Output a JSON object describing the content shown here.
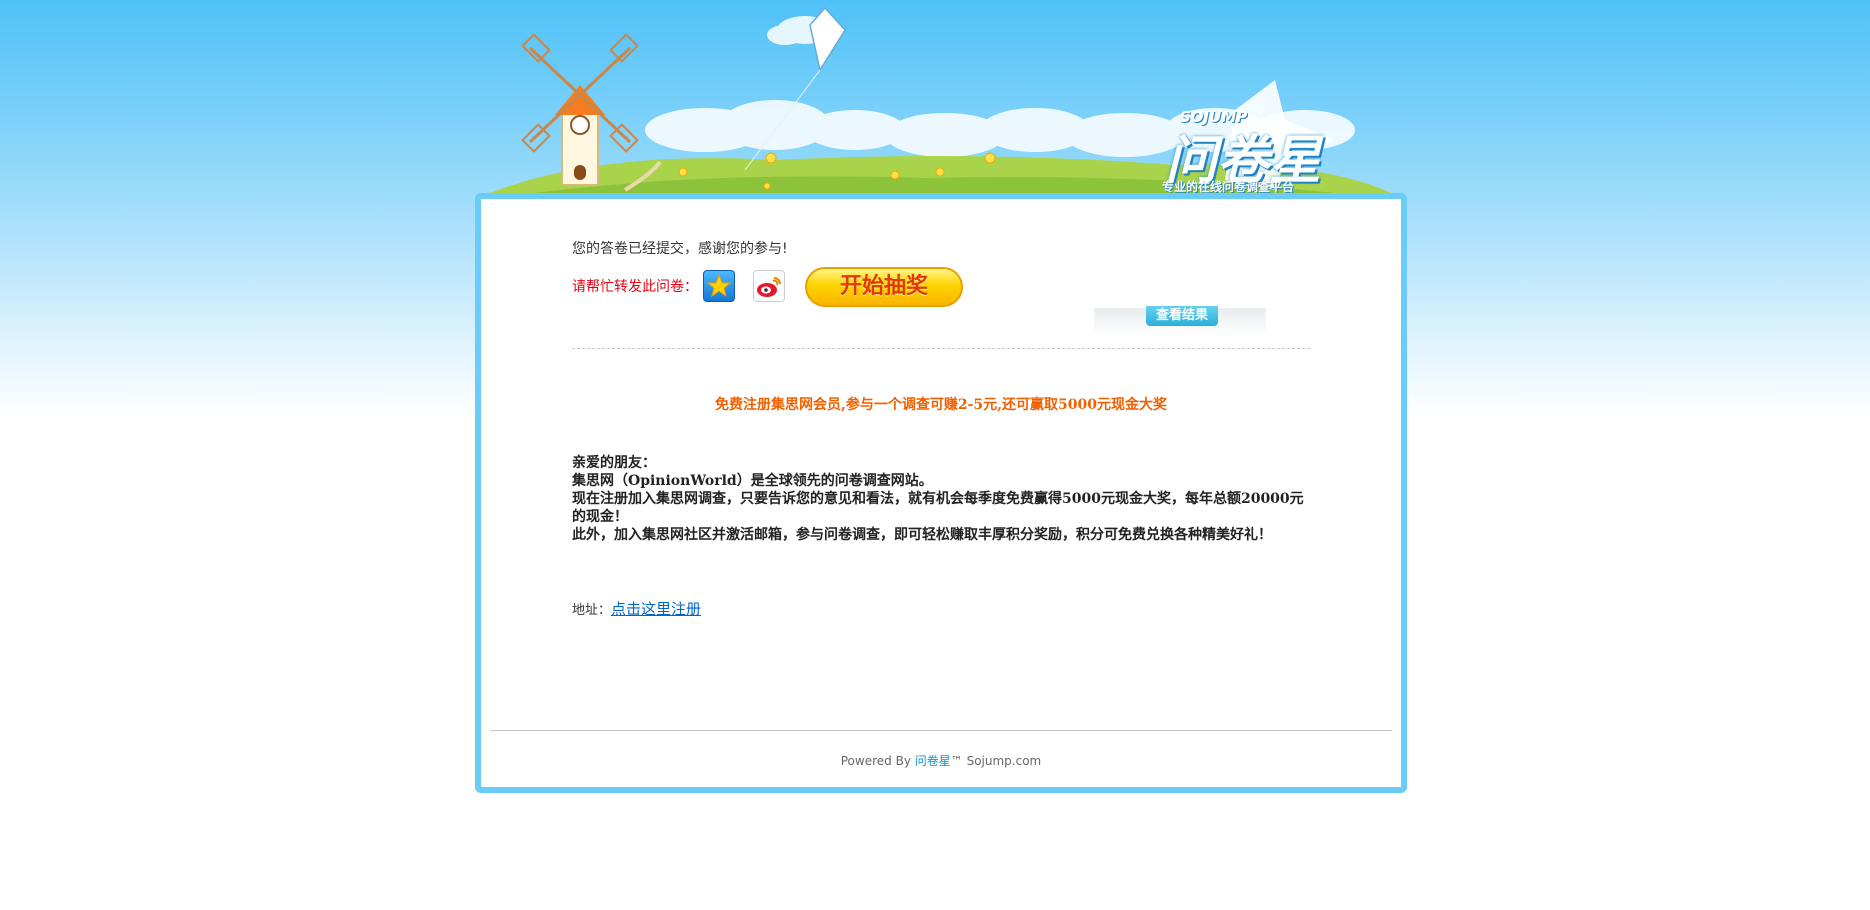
{
  "banner": {
    "logo_en": "SOJUMP",
    "logo_cn": "问卷星",
    "slogan": "专业的在线问卷调查平台"
  },
  "main": {
    "submitted_message": "您的答卷已经提交，感谢您的参与!",
    "share_label": "请帮忙转发此问卷：",
    "share_icons": [
      "qzone-icon",
      "weibo-icon"
    ],
    "lottery_button": "开始抽奖",
    "view_results_button": "查看结果",
    "promo_title": "免费注册集思网会员,参与一个调查可赚2-5元,还可赢取5000元现金大奖",
    "letter": {
      "greeting": "亲爱的朋友：",
      "line1": "集思网（OpinionWorld）是全球领先的问卷调查网站。",
      "line2": "现在注册加入集思网调查，只要告诉您的意见和看法，就有机会每季度免费赢得5000元现金大奖，每年总额20000元的现金！",
      "line3": "此外，加入集思网社区并激活邮箱，参与问卷调查，即可轻松赚取丰厚积分奖励，积分可免费兑换各种精美好礼！"
    },
    "address_label": "地址：",
    "register_link": "点击这里注册"
  },
  "footer": {
    "powered_by": "Powered By",
    "brand": "问卷星",
    "suffix": "™ Sojump.com"
  },
  "colors": {
    "frame": "#69cdf8",
    "accent_red": "#e60012",
    "promo_orange": "#f06000",
    "link_blue": "#0066cc"
  }
}
